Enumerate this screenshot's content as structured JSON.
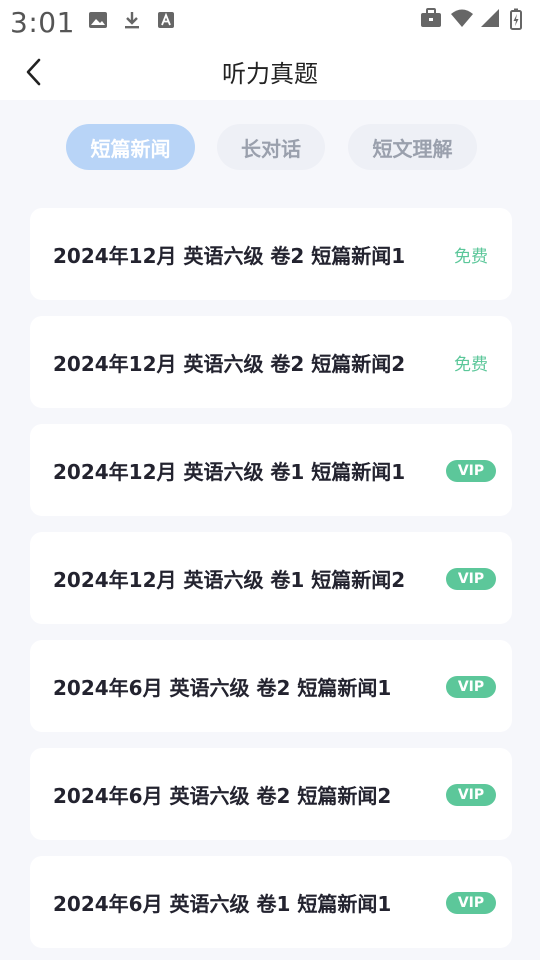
{
  "status_bar": {
    "time": "3:01",
    "left_icons": [
      "image-icon",
      "download-icon",
      "keyboard-a-icon"
    ],
    "right_icons": [
      "briefcase-icon",
      "wifi-icon",
      "signal-icon",
      "battery-charging-icon"
    ]
  },
  "header": {
    "title": "听力真题",
    "back_icon": "chevron-left-icon"
  },
  "tabs": [
    {
      "label": "短篇新闻",
      "active": true
    },
    {
      "label": "长对话",
      "active": false
    },
    {
      "label": "短文理解",
      "active": false
    }
  ],
  "items": [
    {
      "title": "2024年12月 英语六级 卷2 短篇新闻1",
      "badge": "免费",
      "badge_type": "free"
    },
    {
      "title": "2024年12月 英语六级 卷2 短篇新闻2",
      "badge": "免费",
      "badge_type": "free"
    },
    {
      "title": "2024年12月 英语六级 卷1 短篇新闻1",
      "badge": "VIP",
      "badge_type": "vip"
    },
    {
      "title": "2024年12月 英语六级 卷1 短篇新闻2",
      "badge": "VIP",
      "badge_type": "vip"
    },
    {
      "title": "2024年6月 英语六级 卷2 短篇新闻1",
      "badge": "VIP",
      "badge_type": "vip"
    },
    {
      "title": "2024年6月 英语六级 卷2 短篇新闻2",
      "badge": "VIP",
      "badge_type": "vip"
    },
    {
      "title": "2024年6月 英语六级 卷1 短篇新闻1",
      "badge": "VIP",
      "badge_type": "vip"
    }
  ],
  "colors": {
    "active_tab_bg": "#b8d4f7",
    "inactive_tab_bg": "#eef0f6",
    "badge_green": "#5cc79a",
    "page_bg": "#f6f7fb"
  }
}
